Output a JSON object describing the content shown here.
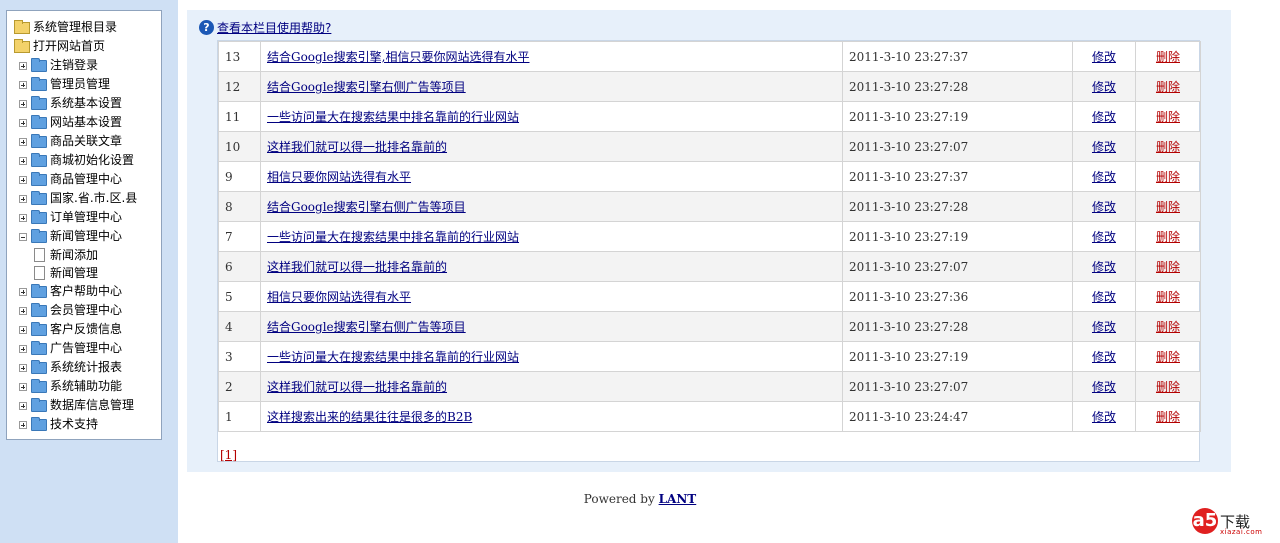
{
  "tree": {
    "root": "系统管理根目录",
    "home": "打开网站首页",
    "items": [
      {
        "label": "注销登录",
        "state": "collapsed"
      },
      {
        "label": "管理员管理",
        "state": "collapsed"
      },
      {
        "label": "系统基本设置",
        "state": "collapsed"
      },
      {
        "label": "网站基本设置",
        "state": "collapsed"
      },
      {
        "label": "商品关联文章",
        "state": "collapsed"
      },
      {
        "label": "商城初始化设置",
        "state": "collapsed"
      },
      {
        "label": "商品管理中心",
        "state": "collapsed"
      },
      {
        "label": "国家.省.市.区.县",
        "state": "collapsed"
      },
      {
        "label": "订单管理中心",
        "state": "collapsed"
      },
      {
        "label": "新闻管理中心",
        "state": "expanded",
        "children": [
          "新闻添加",
          "新闻管理"
        ]
      },
      {
        "label": "客户帮助中心",
        "state": "collapsed"
      },
      {
        "label": "会员管理中心",
        "state": "collapsed"
      },
      {
        "label": "客户反馈信息",
        "state": "collapsed"
      },
      {
        "label": "广告管理中心",
        "state": "collapsed"
      },
      {
        "label": "系统统计报表",
        "state": "collapsed"
      },
      {
        "label": "系统辅助功能",
        "state": "collapsed"
      },
      {
        "label": "数据库信息管理",
        "state": "collapsed"
      },
      {
        "label": "技术支持",
        "state": "collapsed"
      }
    ]
  },
  "help": {
    "icon": "help-icon",
    "text": "查看本栏目使用帮助?"
  },
  "news": {
    "edit_label": "修改",
    "delete_label": "删除",
    "rows": [
      {
        "id": "13",
        "title": "结合Google搜索引擎,相信只要你网站选得有水平",
        "time": "2011-3-10 23:27:37"
      },
      {
        "id": "12",
        "title": "结合Google搜索引擎右侧广告等项目",
        "time": "2011-3-10 23:27:28"
      },
      {
        "id": "11",
        "title": "一些访问量大在搜索结果中排名靠前的行业网站",
        "time": "2011-3-10 23:27:19"
      },
      {
        "id": "10",
        "title": "这样我们就可以得一批排名靠前的",
        "time": "2011-3-10 23:27:07"
      },
      {
        "id": "9",
        "title": "相信只要你网站选得有水平",
        "time": "2011-3-10 23:27:37"
      },
      {
        "id": "8",
        "title": "结合Google搜索引擎右侧广告等项目",
        "time": "2011-3-10 23:27:28"
      },
      {
        "id": "7",
        "title": "一些访问量大在搜索结果中排名靠前的行业网站",
        "time": "2011-3-10 23:27:19"
      },
      {
        "id": "6",
        "title": "这样我们就可以得一批排名靠前的",
        "time": "2011-3-10 23:27:07"
      },
      {
        "id": "5",
        "title": "相信只要你网站选得有水平",
        "time": "2011-3-10 23:27:36"
      },
      {
        "id": "4",
        "title": "结合Google搜索引擎右侧广告等项目",
        "time": "2011-3-10 23:27:28"
      },
      {
        "id": "3",
        "title": "一些访问量大在搜索结果中排名靠前的行业网站",
        "time": "2011-3-10 23:27:19"
      },
      {
        "id": "2",
        "title": "这样我们就可以得一批排名靠前的",
        "time": "2011-3-10 23:27:07"
      },
      {
        "id": "1",
        "title": "这样搜索出来的结果往往是很多的B2B",
        "time": "2011-3-10 23:24:47"
      }
    ]
  },
  "pager": {
    "current": "[1]"
  },
  "footer": {
    "prefix": "Powered by",
    "link": "LANT"
  },
  "watermark": {
    "mark": "a5",
    "main": "下载",
    "sub": "xiazai.com"
  }
}
